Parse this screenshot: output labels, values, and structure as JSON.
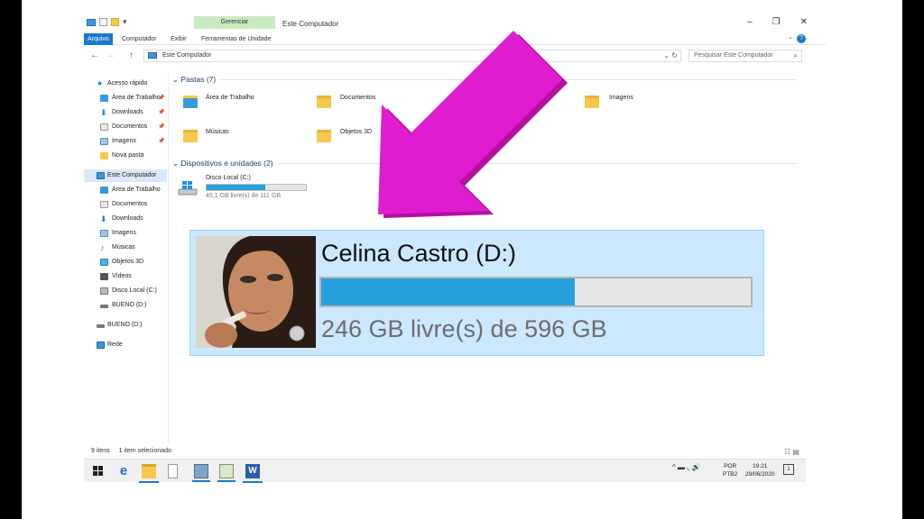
{
  "window": {
    "title": "Este Computador",
    "manage_tab": "Gerenciar",
    "controls": {
      "minimize": "–",
      "maximize": "❐",
      "close": "✕"
    }
  },
  "ribbon": {
    "tabs": [
      "Arquivo",
      "Computador",
      "Exibir",
      "Ferramentas de Unidade"
    ],
    "help": "?",
    "collapse": "⌄"
  },
  "address": {
    "back": "←",
    "forward": "→",
    "up": "↑",
    "path": "Este Computador",
    "dropdown": "⌄",
    "refresh": "↻",
    "search_placeholder": "Pesquisar Este Computador",
    "search_icon": "⌕"
  },
  "sidebar": {
    "items": [
      {
        "label": "Acesso rápido",
        "icon": "star-icon"
      },
      {
        "label": "Área de Trabalho",
        "icon": "desktop-folder-icon"
      },
      {
        "label": "Downloads",
        "icon": "download-icon"
      },
      {
        "label": "Documentos",
        "icon": "documents-icon"
      },
      {
        "label": "Imagens",
        "icon": "images-icon"
      },
      {
        "label": "Nova pasta",
        "icon": "folder-icon"
      },
      {
        "label": "Este Computador",
        "icon": "computer-icon"
      },
      {
        "label": "Área de Trabalho",
        "icon": "desktop-folder-icon"
      },
      {
        "label": "Documentos",
        "icon": "documents-icon"
      },
      {
        "label": "Downloads",
        "icon": "download-icon"
      },
      {
        "label": "Imagens",
        "icon": "images-icon"
      },
      {
        "label": "Músicas",
        "icon": "music-icon"
      },
      {
        "label": "Objetos 3D",
        "icon": "objects-3d-icon"
      },
      {
        "label": "Vídeos",
        "icon": "videos-icon"
      },
      {
        "label": "Disco Local (C:)",
        "icon": "drive-icon"
      },
      {
        "label": "BUENO (D:)",
        "icon": "drive-icon"
      },
      {
        "label": "BUENO (D:)",
        "icon": "drive-icon"
      },
      {
        "label": "Rede",
        "icon": "network-icon"
      }
    ]
  },
  "content": {
    "folders_header": "Pastas (7)",
    "folders": [
      "Área de Trabalho",
      "Documentos",
      "Imagens",
      "Músicas",
      "Objetos 3D"
    ],
    "devices_header": "Dispositivos e unidades (2)",
    "drive_c": {
      "name": "Disco Local (C:)",
      "free_text": "45,1 GB livre(s) de 111 GB",
      "used_fraction": 0.59
    }
  },
  "zoom": {
    "drive_name": "Celina Castro (D:)",
    "free_text": "246 GB livre(s) de 596 GB",
    "used_fraction": 0.59
  },
  "statusbar": {
    "items": "9 itens",
    "selected": "1 item selecionado",
    "views": "☷ ▤"
  },
  "taskbar": {
    "tray": "^ ▬ ◟ 🔊",
    "lang_top": "POR",
    "lang_bottom": "PTB2",
    "time": "19:21",
    "date": "29/06/2020",
    "notifications": "1"
  },
  "colors": {
    "accent": "#1979ca",
    "selection": "#cce8ff",
    "bar_fill": "#26a0da",
    "arrow": "#e01ccf"
  }
}
